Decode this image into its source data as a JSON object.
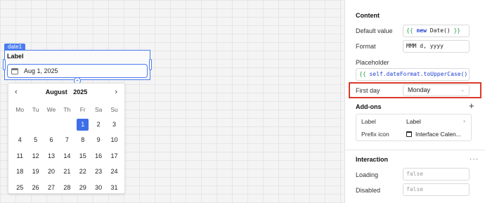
{
  "component": {
    "tag": "date1",
    "label": "Label",
    "value": "Aug 1, 2025"
  },
  "calendar": {
    "month": "August",
    "year": "2025",
    "prev": "‹",
    "next": "›",
    "weekdays": [
      "Mo",
      "Tu",
      "We",
      "Th",
      "Fr",
      "Sa",
      "Su"
    ],
    "weeks": [
      [
        "",
        "",
        "",
        "",
        "1",
        "2",
        "3"
      ],
      [
        "4",
        "5",
        "6",
        "7",
        "8",
        "9",
        "10"
      ],
      [
        "11",
        "12",
        "13",
        "14",
        "15",
        "16",
        "17"
      ],
      [
        "18",
        "19",
        "20",
        "21",
        "22",
        "23",
        "24"
      ],
      [
        "25",
        "26",
        "27",
        "28",
        "29",
        "30",
        "31"
      ]
    ],
    "selected": "1"
  },
  "panel": {
    "content_title": "Content",
    "default_value_label": "Default value",
    "default_value": {
      "open": "{{",
      "kw": "new",
      "rest": "Date()",
      "close": "}}"
    },
    "format_label": "Format",
    "format_value": "MMM d, yyyy",
    "placeholder_label": "Placeholder",
    "placeholder_value": {
      "open": "{{",
      "obj": "self",
      "rest": ".dateFormat.toUpperCase()",
      "close": "}}"
    },
    "first_day_label": "First day",
    "first_day_value": "Monday",
    "addons_title": "Add-ons",
    "addons_plus": "+",
    "addons": {
      "label_row": "Label",
      "label_value": "Label",
      "prefix_row": "Prefix icon",
      "prefix_value": "Interface Calen..."
    },
    "interaction_title": "Interaction",
    "more": "···",
    "loading_label": "Loading",
    "loading_value": "false",
    "disabled_label": "Disabled",
    "disabled_value": "false"
  },
  "colors": {
    "accent": "#3f6fe8",
    "highlight": "#d93a2b"
  }
}
